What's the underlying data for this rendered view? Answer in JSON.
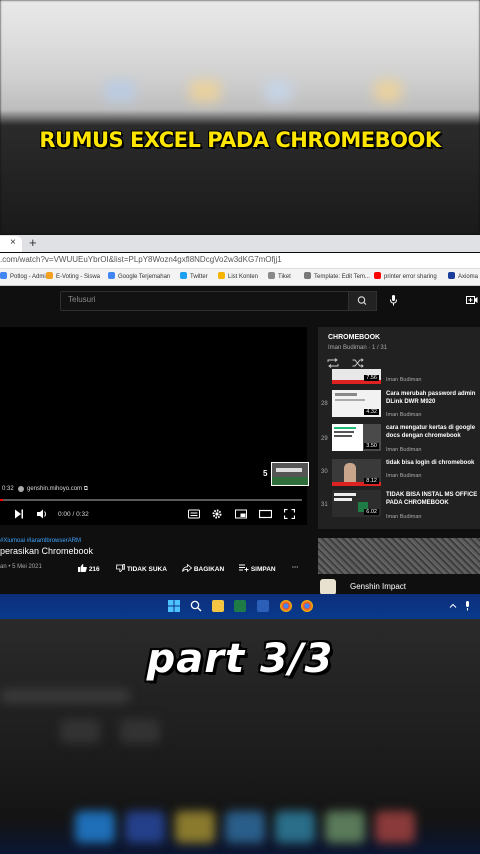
{
  "overlay": {
    "top_caption": "RUMUS EXCEL PADA CHROMEBOOK",
    "bottom_caption": "part 3/3"
  },
  "browser": {
    "tab_close": "×",
    "new_tab": "+",
    "url": ".com/watch?v=VWUUEuYbrOI&list=PLpY8Wozn4gxfl8NDcgVo2w3dKG7mOfjj1",
    "bookmarks": [
      {
        "label": "Potlog - Admin",
        "color": "#4285f4"
      },
      {
        "label": "E-Voting - Siswa",
        "color": "#f4a020"
      },
      {
        "label": "Google Terjemahan",
        "color": "#4285f4"
      },
      {
        "label": "Twitter",
        "color": "#1da1f2"
      },
      {
        "label": "List Konten",
        "color": "#f4b400"
      },
      {
        "label": "Tiket",
        "color": "#888888"
      },
      {
        "label": "Template: Edit Tem...",
        "color": "#777777"
      },
      {
        "label": "printer error sharing",
        "color": "#ff0000"
      },
      {
        "label": "Axioma",
        "color": "#1a3c9a"
      }
    ]
  },
  "youtube": {
    "search_placeholder": "Telusuri",
    "video": {
      "end_card_number": "5",
      "watermark": "genshin.mihoyo.com ⧉",
      "timestamp_left": "0:32",
      "time": "0:00 / 0:32",
      "progress_fraction": 0.01,
      "hashtags": "#Xiumoai #laramlbrowserARM",
      "title": "perasikan Chromebook",
      "meta": "an • 5 Mei 2021",
      "actions": {
        "like_count": "216",
        "dislike": "TIDAK SUKA",
        "share": "BAGIKAN",
        "save": "SIMPAN",
        "more": "···"
      }
    },
    "playlist": {
      "title": "CHROMEBOOK",
      "subtitle": "Iman Budiman · 1 / 31",
      "items": [
        {
          "num": "",
          "duration": "7.56",
          "title": "",
          "author": "Iman Budiman"
        },
        {
          "num": "28",
          "duration": "4.32",
          "title": "Cara merubah password admin DLink DWR M920",
          "author": "Iman Budiman"
        },
        {
          "num": "29",
          "duration": "3.50",
          "title": "cara mengatur kertas di google docs dengan chromebook",
          "author": "Iman Budiman"
        },
        {
          "num": "30",
          "duration": "8.12",
          "title": "tidak bisa login di chromebook",
          "author": "Iman Budiman"
        },
        {
          "num": "31",
          "duration": "6.02",
          "title": "TIDAK BISA INSTAL MS OFFICE PADA CHROMEBOOK",
          "author": "Iman Budiman"
        }
      ]
    },
    "recommended": {
      "label": "Genshin Impact"
    }
  },
  "colors": {
    "caption_yellow": "#ffe600",
    "youtube_bg": "#0f0f0f",
    "taskbar": "#0a3a8c",
    "progress_red": "#ff0000"
  },
  "icons": {
    "search": "search-icon",
    "mic": "mic-icon",
    "create": "create-video-icon",
    "play": "play-icon",
    "volume": "volume-icon",
    "captions": "captions-icon",
    "settings": "gear-icon",
    "miniplayer": "miniplayer-icon",
    "theater": "theater-icon",
    "fullscreen": "fullscreen-icon",
    "like": "thumbs-up-icon",
    "dislike": "thumbs-down-icon",
    "share": "share-icon",
    "save": "save-playlist-icon",
    "loop": "loop-icon",
    "shuffle": "shuffle-icon"
  }
}
